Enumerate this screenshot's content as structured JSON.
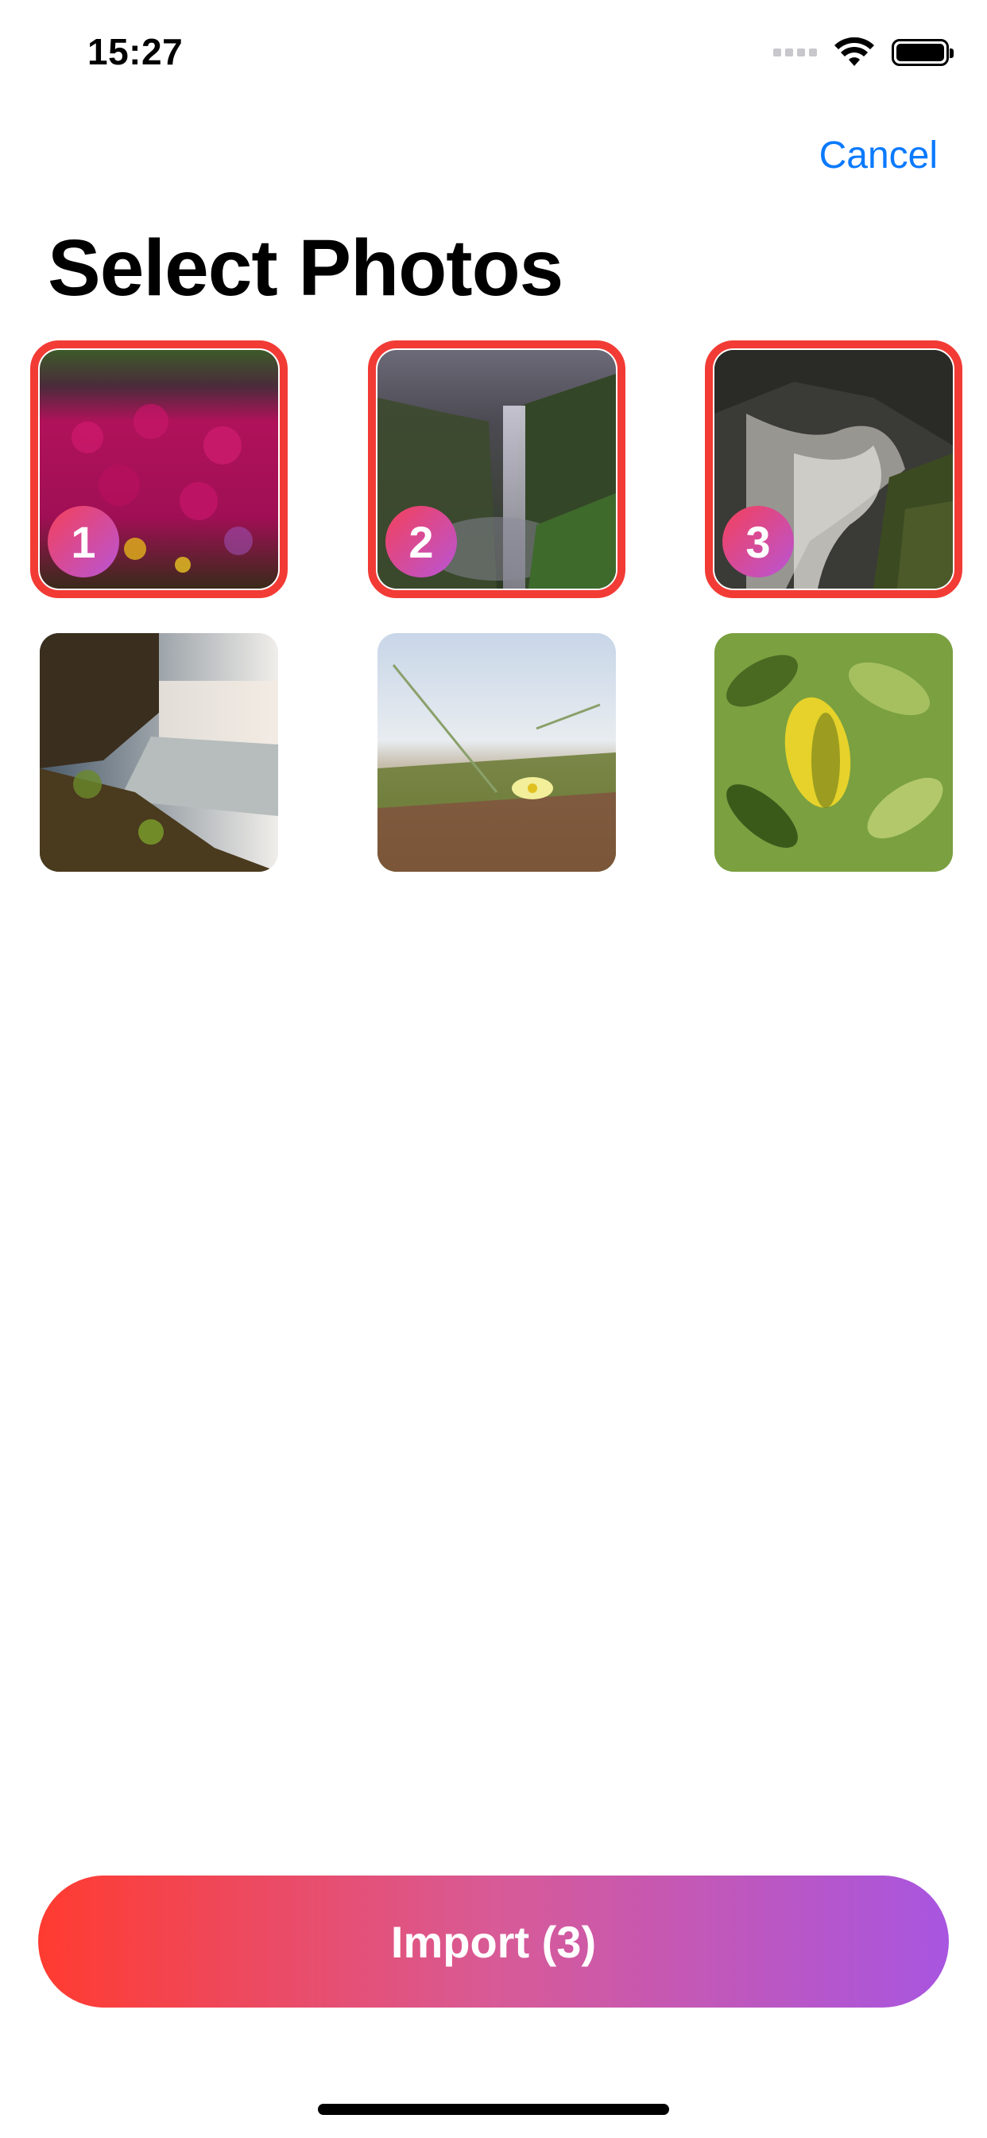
{
  "status_bar": {
    "time": "15:27",
    "wifi_icon": "wifi-icon",
    "battery_icon": "battery-icon",
    "signal_icon": "cellular-signal-icon"
  },
  "nav": {
    "cancel_label": "Cancel"
  },
  "title": "Select Photos",
  "photos": [
    {
      "description_icon": "photo-pink-flowers",
      "selected": true,
      "order": "1"
    },
    {
      "description_icon": "photo-waterfall-cliff",
      "selected": true,
      "order": "2"
    },
    {
      "description_icon": "photo-waterfall-rocks",
      "selected": true,
      "order": "3"
    },
    {
      "description_icon": "photo-waterfall-sunlit",
      "selected": false,
      "order": ""
    },
    {
      "description_icon": "photo-dune-flower",
      "selected": false,
      "order": ""
    },
    {
      "description_icon": "photo-green-leaves",
      "selected": false,
      "order": ""
    }
  ],
  "import_button": {
    "label": "Import (3)"
  },
  "colors": {
    "accent_blue": "#0a7aff",
    "selection_red": "#f23b35",
    "gradient_start": "#ff3b30",
    "gradient_end": "#a855e0"
  }
}
